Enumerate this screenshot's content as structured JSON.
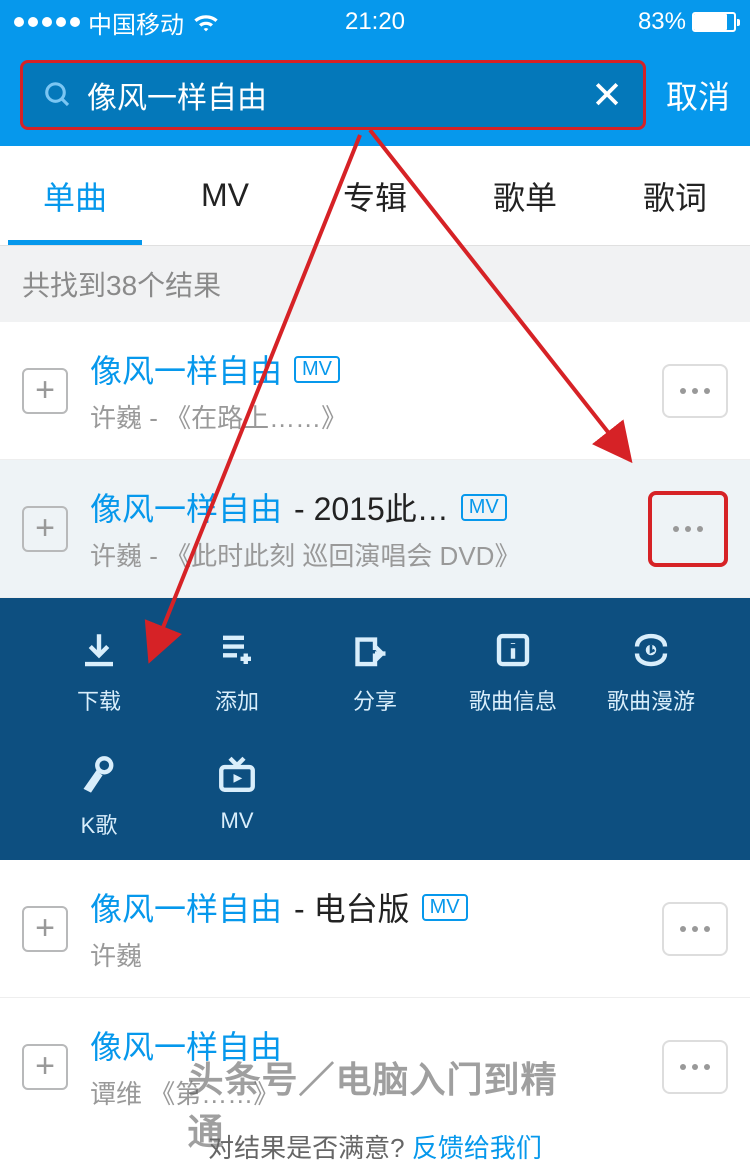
{
  "status": {
    "carrier": "中国移动",
    "time": "21:20",
    "battery_pct": "83%"
  },
  "search": {
    "value": "像风一样自由",
    "cancel": "取消"
  },
  "tabs": [
    "单曲",
    "MV",
    "专辑",
    "歌单",
    "歌词"
  ],
  "active_tab": 0,
  "results_count": "共找到38个结果",
  "songs": [
    {
      "title": "像风一样自由",
      "suffix": "",
      "mv": true,
      "sub": "许巍 - 《在路上……》"
    },
    {
      "title": "像风一样自由",
      "suffix": " - 2015此…",
      "mv": true,
      "sub": "许巍 - 《此时此刻 巡回演唱会 DVD》",
      "expanded": true,
      "highlight_more": true
    },
    {
      "title": "像风一样自由",
      "suffix": " - 电台版",
      "mv": true,
      "sub": "许巍"
    },
    {
      "title": "像风一样自由",
      "suffix": "",
      "mv": false,
      "sub": "谭维 《第……》"
    }
  ],
  "actions": [
    {
      "key": "download",
      "label": "下载"
    },
    {
      "key": "add",
      "label": "添加"
    },
    {
      "key": "share",
      "label": "分享"
    },
    {
      "key": "info",
      "label": "歌曲信息"
    },
    {
      "key": "roam",
      "label": "歌曲漫游"
    },
    {
      "key": "ktv",
      "label": "K歌"
    },
    {
      "key": "mv",
      "label": "MV"
    }
  ],
  "footer": {
    "q": "对结果是否满意?",
    "link": "反馈给我们"
  },
  "watermark": "头条号／电脑入门到精通"
}
